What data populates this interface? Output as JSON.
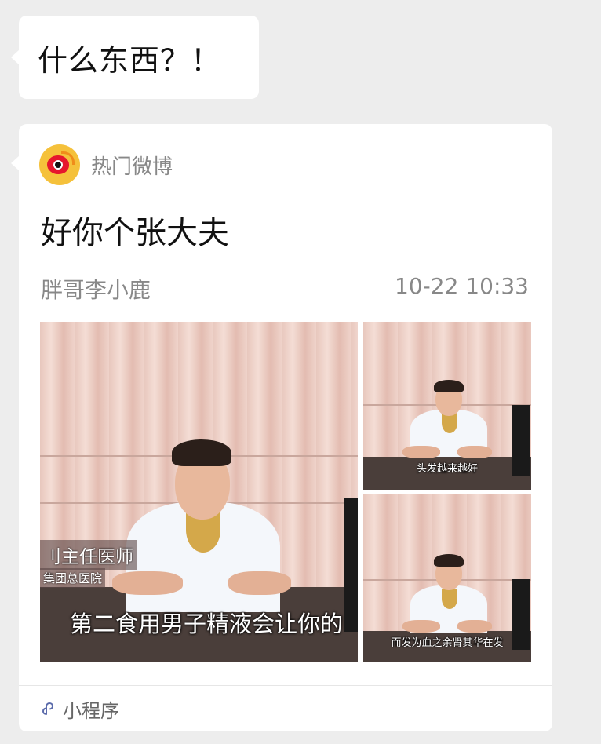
{
  "message": {
    "text": "什么东西？！"
  },
  "card": {
    "source": {
      "name": "热门微博",
      "icon": "weibo-logo-icon"
    },
    "title": "好你个张大夫",
    "author": "胖哥李小鹿",
    "time": "10-22 10:33",
    "images": {
      "main": {
        "side_line1": "刂主任医师",
        "side_line2": "集团总医院",
        "caption": "第二食用男子精液会让你的"
      },
      "top_right": {
        "caption": "头发越来越好"
      },
      "bottom_right": {
        "caption": "而发为血之余肾其华在发"
      }
    },
    "footer": {
      "label": "小程序",
      "icon": "mini-program-icon"
    }
  },
  "colors": {
    "background": "#ededed",
    "bubble": "#ffffff",
    "weibo_red": "#e6162d",
    "weibo_yellow": "#f5c13b",
    "meta_gray": "#888888"
  }
}
